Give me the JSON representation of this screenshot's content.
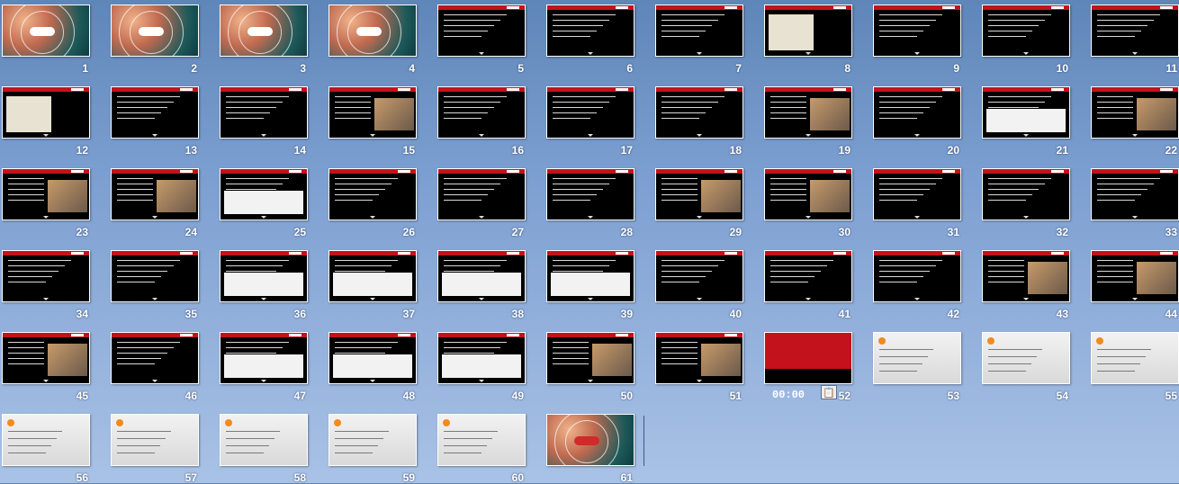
{
  "slides": [
    {
      "n": "1",
      "style": "cover"
    },
    {
      "n": "2",
      "style": "cover"
    },
    {
      "n": "3",
      "style": "cover"
    },
    {
      "n": "4",
      "style": "cover"
    },
    {
      "n": "5",
      "style": "black"
    },
    {
      "n": "6",
      "style": "red"
    },
    {
      "n": "7",
      "style": "red"
    },
    {
      "n": "8",
      "style": "map"
    },
    {
      "n": "9",
      "style": "red"
    },
    {
      "n": "10",
      "style": "red"
    },
    {
      "n": "11",
      "style": "red"
    },
    {
      "n": "12",
      "style": "map"
    },
    {
      "n": "13",
      "style": "red"
    },
    {
      "n": "14",
      "style": "red"
    },
    {
      "n": "15",
      "style": "photo"
    },
    {
      "n": "16",
      "style": "red"
    },
    {
      "n": "17",
      "style": "red"
    },
    {
      "n": "18",
      "style": "red"
    },
    {
      "n": "19",
      "style": "photo"
    },
    {
      "n": "20",
      "style": "red"
    },
    {
      "n": "21",
      "style": "white"
    },
    {
      "n": "22",
      "style": "photo"
    },
    {
      "n": "23",
      "style": "photo"
    },
    {
      "n": "24",
      "style": "photo"
    },
    {
      "n": "25",
      "style": "white"
    },
    {
      "n": "26",
      "style": "red"
    },
    {
      "n": "27",
      "style": "red"
    },
    {
      "n": "28",
      "style": "red"
    },
    {
      "n": "29",
      "style": "photo"
    },
    {
      "n": "30",
      "style": "photo"
    },
    {
      "n": "31",
      "style": "red"
    },
    {
      "n": "32",
      "style": "red"
    },
    {
      "n": "33",
      "style": "red"
    },
    {
      "n": "34",
      "style": "red"
    },
    {
      "n": "35",
      "style": "red"
    },
    {
      "n": "36",
      "style": "white"
    },
    {
      "n": "37",
      "style": "white"
    },
    {
      "n": "38",
      "style": "white"
    },
    {
      "n": "39",
      "style": "white"
    },
    {
      "n": "40",
      "style": "red"
    },
    {
      "n": "41",
      "style": "red"
    },
    {
      "n": "42",
      "style": "red"
    },
    {
      "n": "43",
      "style": "photo"
    },
    {
      "n": "44",
      "style": "photo"
    },
    {
      "n": "45",
      "style": "photo"
    },
    {
      "n": "46",
      "style": "red"
    },
    {
      "n": "47",
      "style": "white"
    },
    {
      "n": "48",
      "style": "white"
    },
    {
      "n": "49",
      "style": "white"
    },
    {
      "n": "50",
      "style": "photo"
    },
    {
      "n": "51",
      "style": "photo"
    },
    {
      "n": "52",
      "style": "redcover"
    },
    {
      "n": "53",
      "style": "gray"
    },
    {
      "n": "54",
      "style": "gray"
    },
    {
      "n": "55",
      "style": "gray"
    },
    {
      "n": "56",
      "style": "gray"
    },
    {
      "n": "57",
      "style": "gray"
    },
    {
      "n": "58",
      "style": "gray"
    },
    {
      "n": "59",
      "style": "gray"
    },
    {
      "n": "60",
      "style": "gray"
    },
    {
      "n": "61",
      "style": "cover"
    }
  ],
  "status": {
    "timer": "00:00",
    "paste_icon": "clipboard-icon"
  },
  "colors": {
    "background_top": "#5f86b8",
    "background_bottom": "#a9c2e6",
    "accent_red": "#c3121c"
  }
}
